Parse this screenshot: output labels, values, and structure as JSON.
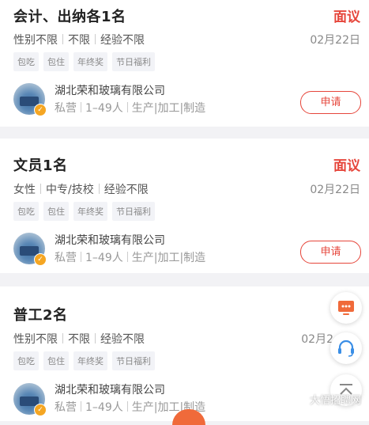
{
  "jobs": [
    {
      "title": "会计、出纳各1名",
      "salary": "面议",
      "requirements": [
        "性别不限",
        "不限",
        "经验不限"
      ],
      "date": "02月22日",
      "tags": [
        "包吃",
        "包住",
        "年终奖",
        "节日福利"
      ],
      "company": "湖北荣和玻璃有限公司",
      "meta": [
        "私营",
        "1–49人",
        "生产|加工|制造"
      ],
      "apply_label": "申请"
    },
    {
      "title": "文员1名",
      "salary": "面议",
      "requirements": [
        "女性",
        "中专/技校",
        "经验不限"
      ],
      "date": "02月22日",
      "tags": [
        "包吃",
        "包住",
        "年终奖",
        "节日福利"
      ],
      "company": "湖北荣和玻璃有限公司",
      "meta": [
        "私营",
        "1–49人",
        "生产|加工|制造"
      ],
      "apply_label": "申请"
    },
    {
      "title": "普工2名",
      "salary": "",
      "requirements": [
        "性别不限",
        "不限",
        "经验不限"
      ],
      "date": "02月2",
      "tags": [
        "包吃",
        "包住",
        "年终奖",
        "节日福利"
      ],
      "company": "湖北荣和玻璃有限公司",
      "meta": [
        "私营",
        "1–49人",
        "生产|加工|制造"
      ],
      "apply_label": ""
    }
  ],
  "watermark": "大悟招聘网",
  "icons": {
    "screen": "monitor-chat-icon",
    "service": "headset-icon",
    "top": "back-to-top-icon"
  },
  "colors": {
    "accent": "#e6463b",
    "float_icon": "#f06a3a",
    "service_icon": "#3a8ee6"
  }
}
